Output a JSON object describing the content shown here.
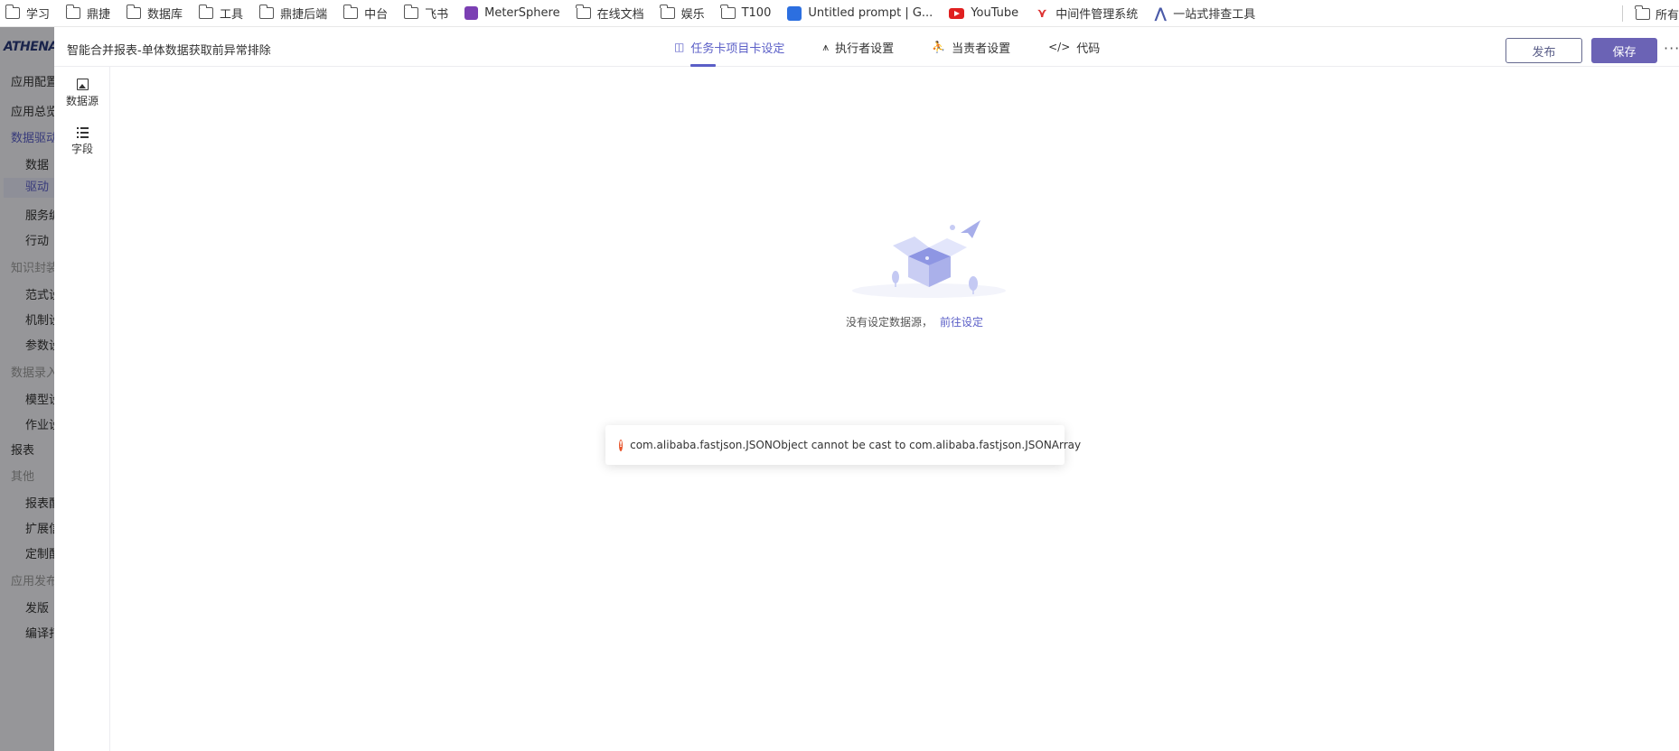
{
  "bookmarks": [
    {
      "label": "学习",
      "icon": "folder-icon"
    },
    {
      "label": "鼎捷",
      "icon": "folder-icon"
    },
    {
      "label": "数据库",
      "icon": "folder-icon"
    },
    {
      "label": "工具",
      "icon": "folder-icon"
    },
    {
      "label": "鼎捷后端",
      "icon": "folder-icon"
    },
    {
      "label": "中台",
      "icon": "folder-icon"
    },
    {
      "label": "飞书",
      "icon": "folder-icon"
    },
    {
      "label": "MeterSphere",
      "icon": "metersphere-icon"
    },
    {
      "label": "在线文档",
      "icon": "folder-icon"
    },
    {
      "label": "娱乐",
      "icon": "folder-icon"
    },
    {
      "label": "T100",
      "icon": "folder-icon"
    },
    {
      "label": "Untitled prompt | G...",
      "icon": "prompt-icon"
    },
    {
      "label": "YouTube",
      "icon": "youtube-icon"
    },
    {
      "label": "中间件管理系统",
      "icon": "middleware-icon"
    },
    {
      "label": "一站式排查工具",
      "icon": "a-logo-icon"
    }
  ],
  "bookmarks_right": {
    "label": "所有"
  },
  "appnav": {
    "logo": "ATHENA",
    "items": [
      {
        "label": "应用配置",
        "type": "item"
      },
      {
        "label": "应用总览",
        "type": "item"
      },
      {
        "label": "数据驱动",
        "type": "active"
      },
      {
        "label": "数据",
        "type": "sub"
      },
      {
        "label": "驱动",
        "type": "sub-selected"
      },
      {
        "label": "服务编",
        "type": "sub"
      },
      {
        "label": "行动",
        "type": "sub"
      },
      {
        "label": "知识封装",
        "type": "group"
      },
      {
        "label": "范式设",
        "type": "sub"
      },
      {
        "label": "机制设",
        "type": "sub"
      },
      {
        "label": "参数设",
        "type": "sub"
      },
      {
        "label": "数据录入",
        "type": "group"
      },
      {
        "label": "模型设",
        "type": "sub"
      },
      {
        "label": "作业设",
        "type": "sub"
      },
      {
        "label": "报表",
        "type": "item"
      },
      {
        "label": "其他",
        "type": "group"
      },
      {
        "label": "报表配",
        "type": "sub"
      },
      {
        "label": "扩展信",
        "type": "sub"
      },
      {
        "label": "定制配",
        "type": "sub"
      },
      {
        "label": "应用发布",
        "type": "group"
      },
      {
        "label": "发版",
        "type": "sub"
      },
      {
        "label": "编译打",
        "type": "sub"
      }
    ]
  },
  "header": {
    "title": "智能合并报表-单体数据获取前异常排除",
    "tabs": [
      {
        "label": "任务卡项目卡设定",
        "icon": "card-icon",
        "glyph": "◫",
        "active": true
      },
      {
        "label": "执行者设置",
        "icon": "executor-icon",
        "glyph": "⩚",
        "active": false
      },
      {
        "label": "当责者设置",
        "icon": "person-icon",
        "glyph": "⛹",
        "active": false
      },
      {
        "label": "代码",
        "icon": "code-icon",
        "glyph": "</>",
        "active": false
      }
    ],
    "publish_label": "发布",
    "save_label": "保存",
    "more_label": "···"
  },
  "tools": [
    {
      "label": "数据源",
      "icon": "image-icon"
    },
    {
      "label": "字段",
      "icon": "list-icon"
    }
  ],
  "empty_state": {
    "text": "没有设定数据源，",
    "link": "前往设定"
  },
  "toast": {
    "type": "error",
    "icon_glyph": "!",
    "message": "com.alibaba.fastjson.JSONObject cannot be cast to com.alibaba.fastjson.JSONArray"
  },
  "colors": {
    "accent": "#5b5fc7",
    "save_button": "#6b63b5",
    "error": "#e8542b"
  }
}
